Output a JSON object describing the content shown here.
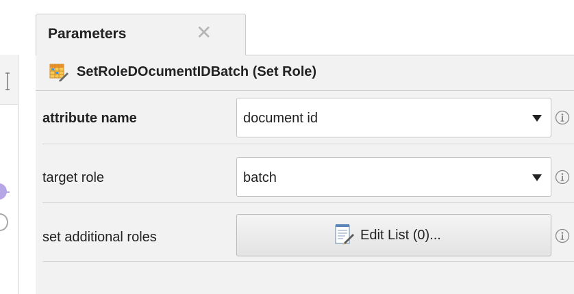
{
  "panel": {
    "tab_label": "Parameters",
    "tab_close_glyph": "✕",
    "operator_title": "SetRoleDOcumentIDBatch (Set Role)",
    "operator_icon": "set-role-operator-icon"
  },
  "parameters": [
    {
      "label": "attribute name",
      "bold": true,
      "control": "select",
      "value": "document id",
      "info_icon": "info-icon"
    },
    {
      "label": "target role",
      "bold": false,
      "control": "select",
      "value": "batch",
      "info_icon": "info-icon"
    },
    {
      "label": "set additional roles",
      "bold": false,
      "control": "button",
      "value": "Edit List (0)...",
      "button_icon": "edit-list-icon",
      "info_icon": "info-icon"
    }
  ],
  "colors": {
    "panel_background": "#f2f2f2",
    "port_purple": "#b7a6e6",
    "separator": "#d6d6d6"
  }
}
